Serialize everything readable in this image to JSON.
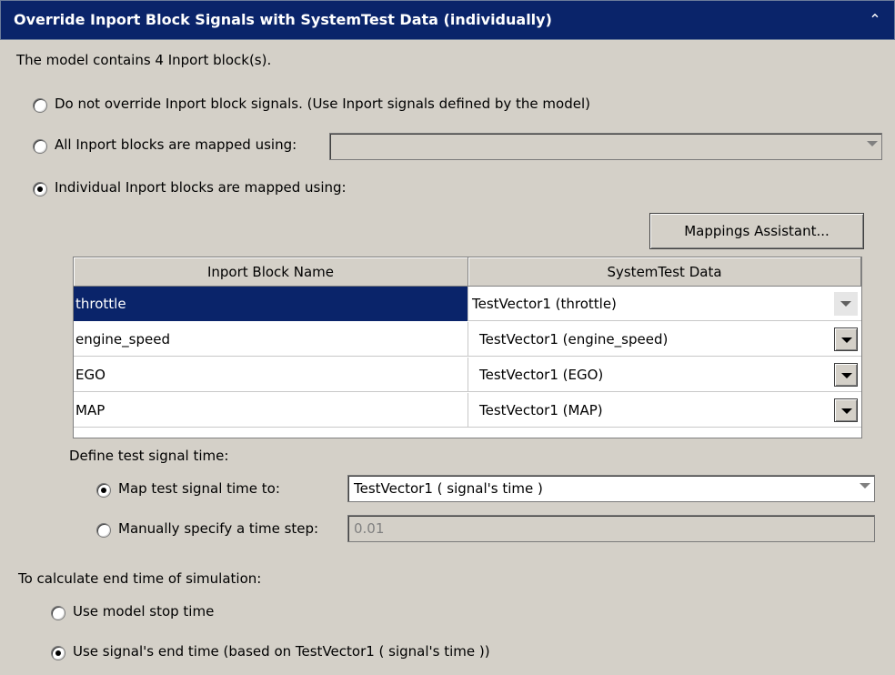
{
  "panel": {
    "title": "Override Inport Block Signals with SystemTest Data (individually)",
    "collapse_icon": "double-chevron-up-icon",
    "model_info": "The model contains 4 Inport block(s)."
  },
  "override_options": [
    {
      "label": "Do not override Inport block signals. (Use Inport signals defined by the model)",
      "checked": false
    },
    {
      "label": "All Inport blocks are mapped using:",
      "checked": false
    },
    {
      "label": "Individual Inport blocks are mapped using:",
      "checked": true
    }
  ],
  "all_mapping_combo": {
    "value": ""
  },
  "mappings_button": {
    "label": "Mappings Assistant..."
  },
  "table": {
    "columns": [
      "Inport Block Name",
      "SystemTest Data"
    ],
    "rows": [
      {
        "name": "throttle",
        "data": "TestVector1 (throttle)",
        "selected": true
      },
      {
        "name": "engine_speed",
        "data": "TestVector1 (engine_speed)",
        "selected": false
      },
      {
        "name": "EGO",
        "data": "TestVector1 (EGO)",
        "selected": false
      },
      {
        "name": "MAP",
        "data": "TestVector1 (MAP)",
        "selected": false
      }
    ]
  },
  "time": {
    "heading": "Define test signal time:",
    "map_label": "Map test signal time to:",
    "map_checked": true,
    "map_value": "TestVector1 ( signal's time )",
    "manual_label": "Manually specify a time step:",
    "manual_checked": false,
    "manual_value": "0.01"
  },
  "end_time": {
    "heading": "To calculate end time of simulation:",
    "options": [
      {
        "label": "Use model stop time",
        "checked": false
      },
      {
        "label": "Use signal's end time (based on TestVector1 ( signal's time ))",
        "checked": true
      }
    ]
  }
}
